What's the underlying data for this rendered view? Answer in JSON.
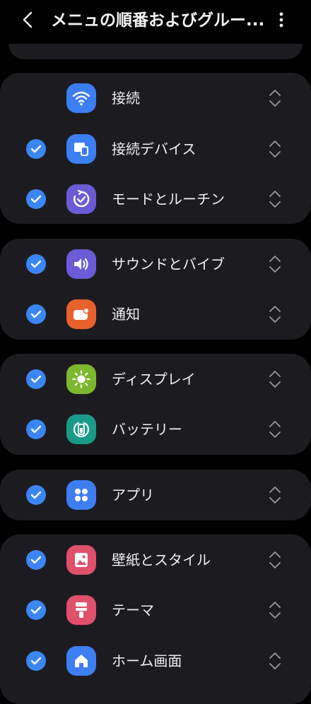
{
  "header": {
    "title": "メニュの順番およびグルー..."
  },
  "colors": {
    "background": "#000000",
    "card": "#1c1c20",
    "check": "#3b86f4",
    "text": "#f0f0f0",
    "handle": "#9a9a9e"
  },
  "groups": [
    {
      "items": [
        {
          "label": "接続",
          "checked": false,
          "icon": "wifi-icon",
          "icon_color": "#3d7ef2"
        },
        {
          "label": "接続デバイス",
          "checked": true,
          "icon": "devices-icon",
          "icon_color": "#3d7ef2"
        },
        {
          "label": "モードとルーチン",
          "checked": true,
          "icon": "modes-routines-icon",
          "icon_color": "#6a5bd6"
        }
      ]
    },
    {
      "items": [
        {
          "label": "サウンドとバイブ",
          "checked": true,
          "icon": "speaker-icon",
          "icon_color": "#6a5bd6"
        },
        {
          "label": "通知",
          "checked": true,
          "icon": "notification-icon",
          "icon_color": "#e8612c"
        }
      ]
    },
    {
      "items": [
        {
          "label": "ディスプレイ",
          "checked": true,
          "icon": "sun-icon",
          "icon_color": "#7cb82f"
        },
        {
          "label": "バッテリー",
          "checked": true,
          "icon": "battery-icon",
          "icon_color": "#1a9b8a"
        }
      ]
    },
    {
      "items": [
        {
          "label": "アプリ",
          "checked": true,
          "icon": "apps-grid-icon",
          "icon_color": "#3d7ef2"
        }
      ]
    },
    {
      "items": [
        {
          "label": "壁紙とスタイル",
          "checked": true,
          "icon": "wallpaper-icon",
          "icon_color": "#e0506b"
        },
        {
          "label": "テーマ",
          "checked": true,
          "icon": "theme-brush-icon",
          "icon_color": "#e0506b"
        },
        {
          "label": "ホーム画面",
          "checked": true,
          "icon": "home-icon",
          "icon_color": "#3d7ef2"
        }
      ]
    }
  ]
}
